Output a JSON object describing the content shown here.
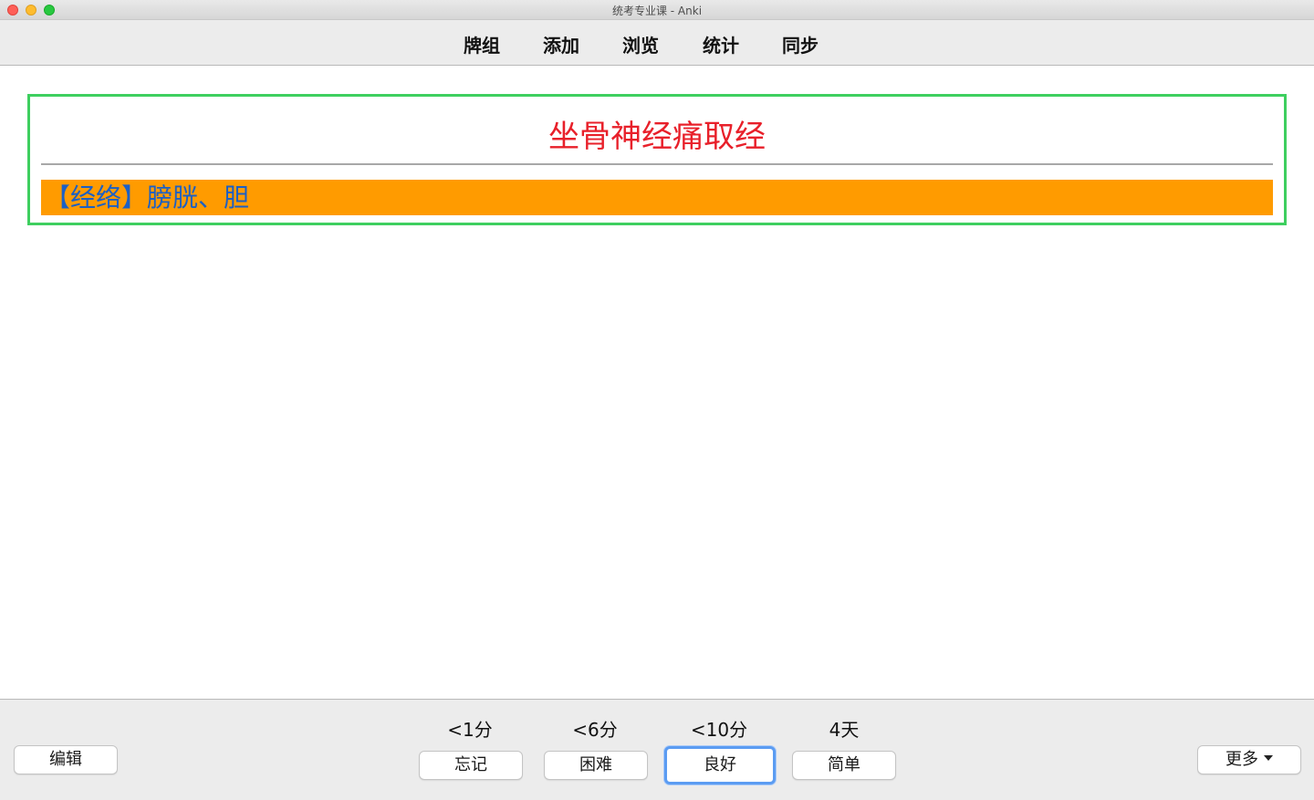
{
  "window": {
    "title": "统考专业课 - Anki"
  },
  "toolbar": {
    "items": [
      {
        "label": "牌组"
      },
      {
        "label": "添加"
      },
      {
        "label": "浏览"
      },
      {
        "label": "统计"
      },
      {
        "label": "同步"
      }
    ]
  },
  "card": {
    "front": "坐骨神经痛取经",
    "back": "【经络】膀胱、胆",
    "colors": {
      "front_text": "#e8202a",
      "back_background": "#ff9b00",
      "back_text": "#1c60c4",
      "frame_border": "#3ecf5f"
    }
  },
  "bottom": {
    "edit_label": "编辑",
    "more_label": "更多",
    "more_icon": "caret-down-icon",
    "answers": [
      {
        "interval": "<1分",
        "label": "忘记"
      },
      {
        "interval": "<6分",
        "label": "困难"
      },
      {
        "interval": "<10分",
        "label": "良好",
        "focused": true
      },
      {
        "interval": "4天",
        "label": "简单"
      }
    ]
  }
}
